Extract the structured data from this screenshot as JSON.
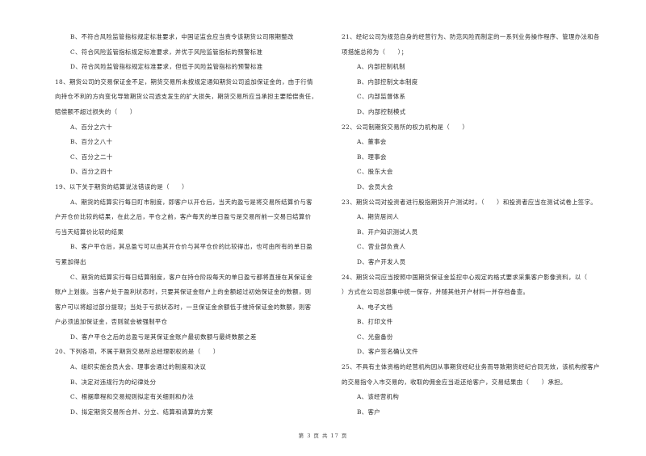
{
  "left_column": [
    {
      "text": "B、不符合风险监管指标规定标准要求，中国证监会应当责令该期货公司限期整改",
      "indent": true
    },
    {
      "text": "C、符合风险监管指标规定标准要求，并优于风险监管指标的预警标准",
      "indent": true
    },
    {
      "text": "D、符合风险监管指标规定标准要求，但低于风险监管指标的预警标准",
      "indent": true
    },
    {
      "text": "18、期货公司的交易保证金不足，期货交易所未按规定通知期货公司追加保证金的，由于行情",
      "indent": false
    },
    {
      "text": "向持仓不利的方向变化导致期货公司透支发生的扩大损失，期货交易所应当承担主要赔偿责任，",
      "indent": false
    },
    {
      "text": "赔偿额不超过损失的（　　）",
      "indent": false
    },
    {
      "text": "A、百分之六十",
      "indent": true
    },
    {
      "text": "B、百分之八十",
      "indent": true
    },
    {
      "text": "C、百分之二十",
      "indent": true
    },
    {
      "text": "D、百分之四十",
      "indent": true
    },
    {
      "text": "19、以下关于期货的结算说法错误的是（　　）",
      "indent": false
    },
    {
      "text": "A、期货的结算实行每日盯市制度，即客户以开仓后，当天的盈亏是将交易所结算价与客",
      "indent": true
    },
    {
      "text": "户开仓价比较的结果，在此之后，平仓之前，客户每天的单日盈亏是交易所前一交易日结算价",
      "indent": false
    },
    {
      "text": "与当天结算价比较的结果",
      "indent": false
    },
    {
      "text": "B、客户平仓后，其总盈亏可以由其开仓价与其平仓价的比较得出，也可由所有的单日盈",
      "indent": true
    },
    {
      "text": "亏累加得出",
      "indent": false
    },
    {
      "text": "C、期货的结算实行每日结算制度，客户在持仓阶段每天的单日盈亏都将直接在其保证金",
      "indent": true
    },
    {
      "text": "账户上划拨。当客户处于盈利状态时，只要其保证金账户上的金额超过初始保证金的数额，则",
      "indent": false
    },
    {
      "text": "客户可以将超过部分提现；当处于亏损状态时，一旦保证金余额低于维持保证金的数额，则客",
      "indent": false
    },
    {
      "text": "户必须追加保证金，否则就会被强制平仓",
      "indent": false
    },
    {
      "text": "D、客户平仓之后的总盈亏是其保证金账户最初数额与最终数额之差",
      "indent": true
    },
    {
      "text": "20、下列各项，不属于期货交易所总经理职权的是（　　）",
      "indent": false
    },
    {
      "text": "A、组织实施会员大会、理事会通过的制度和决议",
      "indent": true
    },
    {
      "text": "B、决定对违规行为的纪律处分",
      "indent": true
    },
    {
      "text": "C、根据章程和交易规则拟定有关细则和办法",
      "indent": true
    },
    {
      "text": "D、拟定期货交易所合并、分立、结算和清算的方案",
      "indent": true
    }
  ],
  "right_column": [
    {
      "text": "21、经纪公司为规范自身的经营行为、防范风险而制定的一系列业务操作程序、管理办法和各",
      "indent": false
    },
    {
      "text": "项措施总称为（　　）；",
      "indent": false
    },
    {
      "text": "A、内部控制机制",
      "indent": true
    },
    {
      "text": "B、内部控制文本制度",
      "indent": true
    },
    {
      "text": "C、内部监督体系",
      "indent": true
    },
    {
      "text": "D、内部控制模式",
      "indent": true
    },
    {
      "text": "22、公司制期货交易所的权力机构是（　　）",
      "indent": false
    },
    {
      "text": "A、董事会",
      "indent": true
    },
    {
      "text": "B、理事会",
      "indent": true
    },
    {
      "text": "C、股东大会",
      "indent": true
    },
    {
      "text": "D、会员大会",
      "indent": true
    },
    {
      "text": "23、期货公司对投资者进行股指期货开户测试时，（　　）和投资者应当在测试试卷上签字。",
      "indent": false
    },
    {
      "text": "A、期货居间人",
      "indent": true
    },
    {
      "text": "B、开户知识测试人员",
      "indent": true
    },
    {
      "text": "C、营业部负责人",
      "indent": true
    },
    {
      "text": "D、客户开发人员",
      "indent": true
    },
    {
      "text": "24、期货公司应当按照中国期货保证金监控中心规定的格式要求采集客户影像资料，以（",
      "indent": false
    },
    {
      "text": "）方式在公司总部集中统一保存，并随其他开户材料一并存档备查。",
      "indent": false
    },
    {
      "text": "A、电子文档",
      "indent": true
    },
    {
      "text": "B、打印文件",
      "indent": true
    },
    {
      "text": "C、光盘备份",
      "indent": true
    },
    {
      "text": "D、客户签名确认文件",
      "indent": true
    },
    {
      "text": "25、不具有主体资格的经营机构因从事期货经纪业务而导致期货经纪合同无效，该机构按客户",
      "indent": false
    },
    {
      "text": "的交易指令入市交易的，收取的佣金应当返还给客户，交易结果由（　　）承担。",
      "indent": false
    },
    {
      "text": "A、该经营机构",
      "indent": true
    },
    {
      "text": "B、客户",
      "indent": true
    }
  ],
  "footer": {
    "page_label": "第 3 页 共 17 页"
  }
}
